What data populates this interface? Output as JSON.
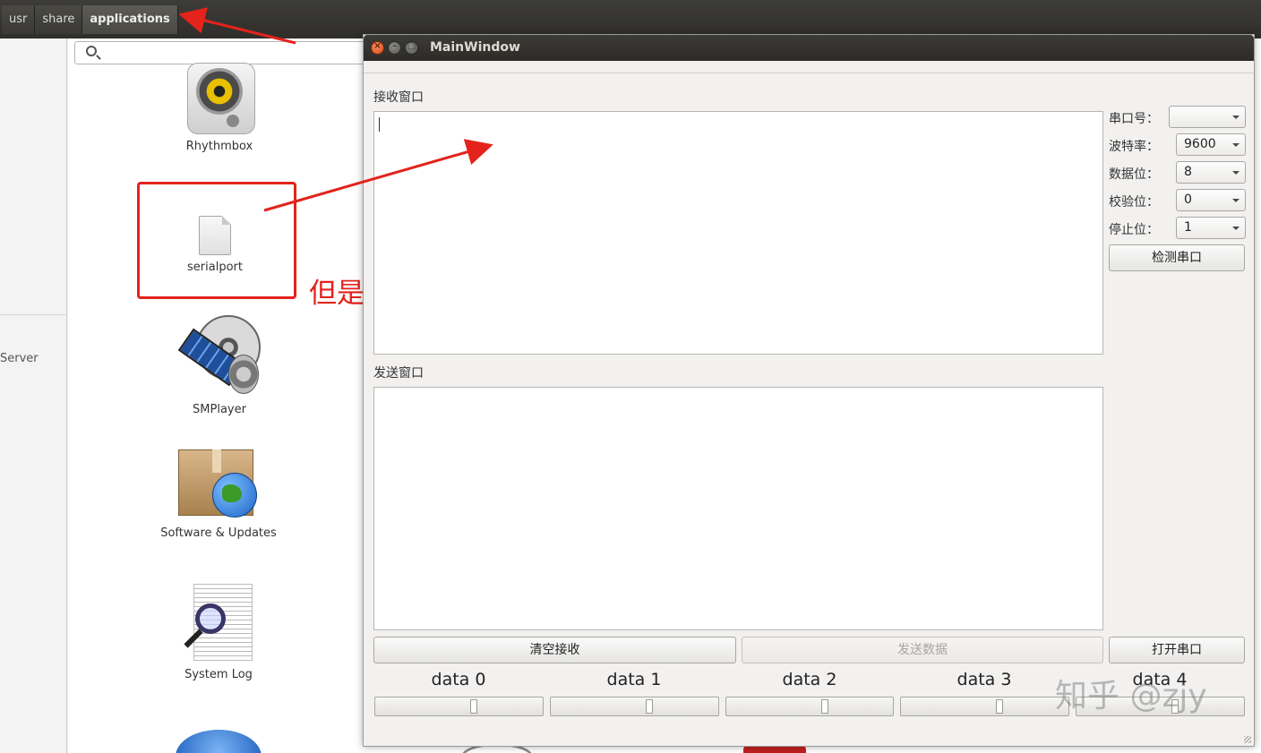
{
  "breadcrumbs": [
    "usr",
    "share",
    "applications"
  ],
  "sidebar": {
    "server_label": "Server"
  },
  "apps": [
    {
      "label": "Rhythmbox",
      "icon": "rhythmbox-speaker-icon"
    },
    {
      "label": "serialport",
      "icon": "generic-file-icon"
    },
    {
      "label": "SMPlayer",
      "icon": "smplayer-icon"
    },
    {
      "label": "Software & Updates",
      "icon": "software-updates-box-icon"
    },
    {
      "label": "System Log",
      "icon": "system-log-magnifier-icon"
    }
  ],
  "annotation": {
    "text": "但是图标没有正确显示",
    "color": "#e3231c"
  },
  "main_window": {
    "title": "MainWindow",
    "receive_label": "接收窗口",
    "send_label": "发送窗口",
    "fields": [
      {
        "label": "串口号：",
        "value": ""
      },
      {
        "label": "波特率：",
        "value": "9600"
      },
      {
        "label": "数据位：",
        "value": "8"
      },
      {
        "label": "校验位：",
        "value": "0"
      },
      {
        "label": "停止位：",
        "value": "1"
      }
    ],
    "detect_button": "检测串口",
    "clear_button": "清空接收",
    "send_button": "发送数据",
    "open_button": "打开串口",
    "sliders": [
      {
        "label": "data 0",
        "value": 0.6
      },
      {
        "label": "data 1",
        "value": 0.6
      },
      {
        "label": "data 2",
        "value": 0.6
      },
      {
        "label": "data 3",
        "value": 0.6
      },
      {
        "label": "data 4",
        "value": 0.6
      }
    ]
  },
  "watermark": "知乎 @zjy"
}
